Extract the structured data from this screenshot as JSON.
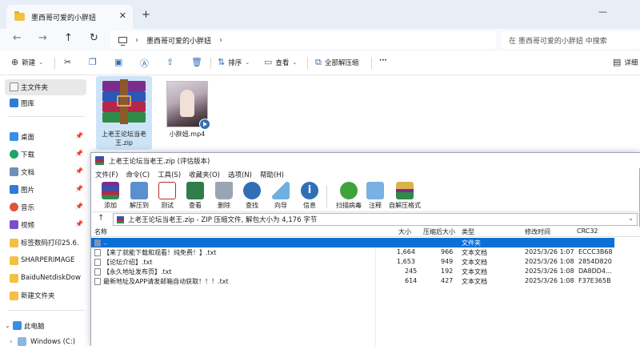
{
  "explorer": {
    "tab_title": "墨西哥可爱的小胖妞",
    "new_tab": "+",
    "close": "✕",
    "window_controls": [
      "—",
      "☐",
      "✕"
    ],
    "nav": {
      "back": "←",
      "forward": "→",
      "up": "↑",
      "refresh": "↻"
    },
    "address": {
      "crumb": "墨西哥可爱的小胖妞",
      "sep": "›",
      "next": "›"
    },
    "search_placeholder": "在 墨西哥可爱的小胖妞 中搜索",
    "commands": {
      "new": "新建",
      "sort": "排序",
      "view": "查看",
      "extract_all": "全部解压缩",
      "more": "···",
      "details": "详细"
    },
    "sidebar": {
      "home": "主文件夹",
      "gallery": "图库",
      "pinned": [
        {
          "label": "桌面",
          "icon": "desktop-icon"
        },
        {
          "label": "下载",
          "icon": "download-icon"
        },
        {
          "label": "文档",
          "icon": "documents-icon"
        },
        {
          "label": "图片",
          "icon": "pictures-icon"
        },
        {
          "label": "音乐",
          "icon": "music-icon"
        },
        {
          "label": "视频",
          "icon": "videos-icon"
        }
      ],
      "folders": [
        "标签数码打印25.6.",
        "SHARPERIMAGE",
        "BaiduNetdiskDow",
        "新建文件夹"
      ],
      "this_pc": "此电脑",
      "drive": "Windows (C:)"
    },
    "files": [
      {
        "name": "上老王论坛当老王.zip",
        "type": "winrar-archive"
      },
      {
        "name": "小胖妞.mp4",
        "type": "video"
      }
    ]
  },
  "winrar": {
    "title": "上老王论坛当老王.zip (评估版本)",
    "menu": [
      "文件(F)",
      "命令(C)",
      "工具(S)",
      "收藏夹(O)",
      "选项(N)",
      "帮助(H)"
    ],
    "tools": [
      "添加",
      "解压到",
      "测试",
      "查看",
      "删除",
      "查找",
      "向导",
      "信息",
      "扫描病毒",
      "注释",
      "自解压格式"
    ],
    "path": "上老王论坛当老王.zip - ZIP 压缩文件, 解包大小为 4,176 字节",
    "columns": [
      "名称",
      "大小",
      "压缩后大小",
      "类型",
      "修改时间",
      "CRC32"
    ],
    "rows": [
      {
        "name": "..",
        "size": "",
        "packed": "",
        "type": "文件夹",
        "modified": "",
        "crc": "",
        "selected": true
      },
      {
        "name": "【来了就能下载和观看！纯免费！】.txt",
        "size": "1,664",
        "packed": "966",
        "type": "文本文档",
        "modified": "2025/3/26 1:07",
        "crc": "ECCC3B68"
      },
      {
        "name": "【论坛介绍】.txt",
        "size": "1,653",
        "packed": "949",
        "type": "文本文档",
        "modified": "2025/3/26 1:08",
        "crc": "2854D820"
      },
      {
        "name": "【永久地址发布页】.txt",
        "size": "245",
        "packed": "192",
        "type": "文本文档",
        "modified": "2025/3/26 1:08",
        "crc": "DA8DD4..."
      },
      {
        "name": "最新地址及APP请发邮箱自动获取！！！.txt",
        "size": "614",
        "packed": "427",
        "type": "文本文档",
        "modified": "2025/3/26 1:08",
        "crc": "F37E365B"
      }
    ]
  }
}
